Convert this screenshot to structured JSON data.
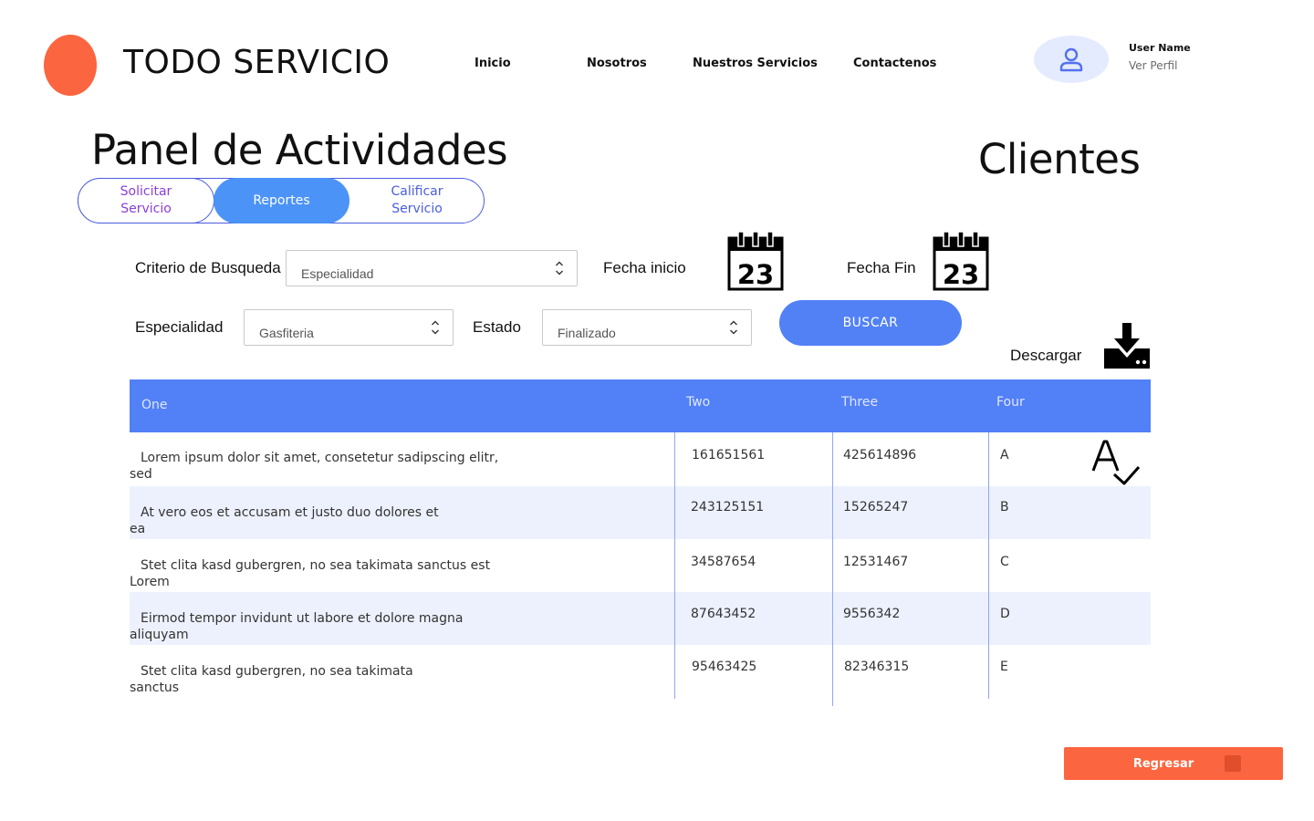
{
  "brand": {
    "name": "TODO SERVICIO",
    "accent": "#fb6540"
  },
  "nav": [
    {
      "label": "Inicio"
    },
    {
      "label": "Nosotros"
    },
    {
      "label": "Nuestros Servicios"
    },
    {
      "label": "Contactenos"
    }
  ],
  "user": {
    "name": "User Name",
    "link": "Ver Perfil",
    "icon": "user-icon"
  },
  "page": {
    "title": "Panel de Actividades",
    "section": "Clientes"
  },
  "tabs": [
    {
      "label": "Solicitar Servicio",
      "active": false
    },
    {
      "label": "Reportes",
      "active": true
    },
    {
      "label": "Calificar Servicio",
      "active": false
    }
  ],
  "filters": {
    "criteria_label": "Criterio de Busqueda",
    "criteria_value": "Especialidad",
    "start_label": "Fecha inicio",
    "end_label": "Fecha Fin",
    "calendar_day": "23",
    "specialty_label": "Especialidad",
    "specialty_value": "Gasfiteria",
    "status_label": "Estado",
    "status_value": "Finalizado",
    "search_button": "BUSCAR",
    "download_label": "Descargar"
  },
  "table": {
    "headers": [
      "One",
      "Two",
      "Three",
      "Four"
    ],
    "rows": [
      {
        "line1": "Lorem ipsum dolor sit amet, consetetur sadipscing elitr,",
        "line2": "sed",
        "two": "161651561",
        "three": "425614896",
        "four": "A"
      },
      {
        "line1": "At vero eos et accusam et justo duo dolores et",
        "line2": "ea",
        "two": "243125151",
        "three": "15265247",
        "four": "B"
      },
      {
        "line1": "Stet clita kasd gubergren, no sea takimata sanctus est",
        "line2": "Lorem",
        "two": "34587654",
        "three": "12531467",
        "four": "C"
      },
      {
        "line1": "Eirmod tempor invidunt ut labore et dolore magna",
        "line2": "aliquyam",
        "two": "87643452",
        "three": "9556342",
        "four": "D"
      },
      {
        "line1": "Stet clita kasd gubergren, no sea takimata",
        "line2": "sanctus",
        "two": "95463425",
        "three": "82346315",
        "four": "E"
      }
    ]
  },
  "back_button": "Regresar",
  "colors": {
    "primary": "#5281f6",
    "tab_active": "#4b93f7",
    "row_alt": "#edf1fd",
    "accent": "#fb6540"
  }
}
